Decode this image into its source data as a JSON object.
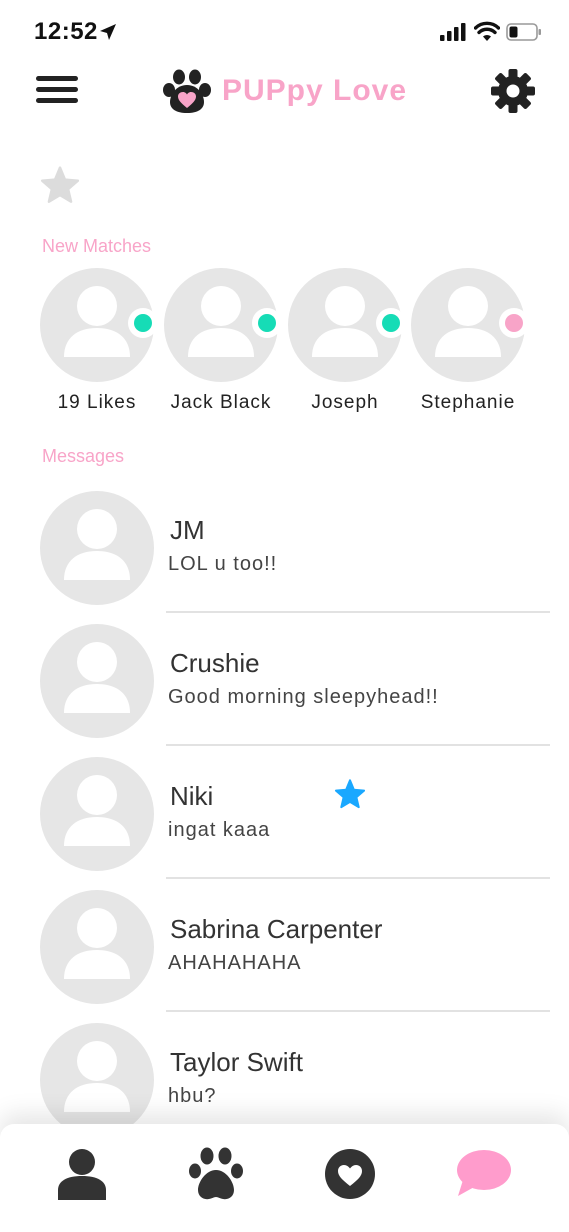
{
  "status_bar": {
    "time": "12:52"
  },
  "header": {
    "app_title": "PUPpy Love"
  },
  "sections": {
    "new_matches": "New Matches",
    "messages": "Messages"
  },
  "matches": [
    {
      "name": "19 Likes",
      "status_color": "#16dcb6"
    },
    {
      "name": "Jack Black",
      "status_color": "#16dcb6"
    },
    {
      "name": "Joseph",
      "status_color": "#16dcb6"
    },
    {
      "name": "Stephanie",
      "status_color": "#f8a4c8"
    }
  ],
  "conversations": [
    {
      "name": "JM",
      "message": "LOL u too!!"
    },
    {
      "name": "Crushie",
      "message": "Good morning sleepyhead!!"
    },
    {
      "name": "Niki",
      "message": "ingat kaaa",
      "starred": true
    },
    {
      "name": "Sabrina Carpenter",
      "message": "AHAHAHAHA"
    },
    {
      "name": "Taylor Swift",
      "message": "hbu?"
    }
  ],
  "tabs": [
    {
      "icon": "profile-icon",
      "active": false
    },
    {
      "icon": "paw-icon",
      "active": false
    },
    {
      "icon": "heart-icon",
      "active": false
    },
    {
      "icon": "chat-icon",
      "active": true
    }
  ],
  "colors": {
    "brand_pink": "#f8a4c8",
    "online_teal": "#16dcb6",
    "star_blue": "#1aa8ff",
    "avatar_gray": "#e6e6e6"
  }
}
